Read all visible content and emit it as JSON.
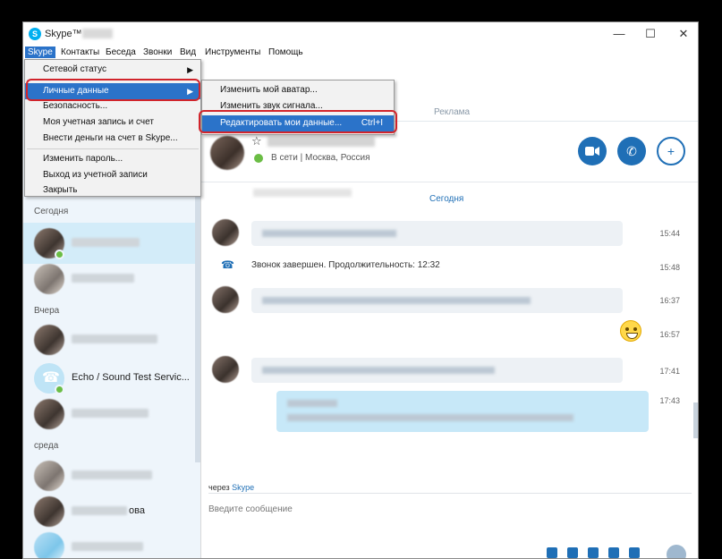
{
  "window": {
    "title": "Skype™ -",
    "controls": [
      "—",
      "☐",
      "✕"
    ]
  },
  "menubar": {
    "items": [
      "Skype",
      "Контакты",
      "Беседа",
      "Звонки",
      "Вид",
      "Инструменты",
      "Помощь"
    ]
  },
  "skype_menu": {
    "items": [
      {
        "label": "Сетевой статус",
        "submenu": true
      },
      {
        "label": "Личные данные",
        "submenu": true,
        "highlighted": true
      },
      {
        "label": "Безопасность..."
      },
      {
        "label": "Моя учетная запись и счет"
      },
      {
        "label": "Внести деньги на счет в Skype..."
      },
      {
        "label": "Изменить пароль..."
      },
      {
        "label": "Выход из учетной записи"
      },
      {
        "label": "Закрыть"
      }
    ]
  },
  "personal_submenu": {
    "items": [
      {
        "label": "Изменить мой аватар..."
      },
      {
        "label": "Изменить звук сигнала..."
      },
      {
        "label": "Редактировать мои данные...",
        "shortcut": "Ctrl+I",
        "highlighted": true
      }
    ]
  },
  "sidebar": {
    "sections": {
      "today": "Сегодня",
      "yesterday": "Вчера",
      "wednesday": "среда"
    },
    "echo_name": "Echo / Sound Test Servic...",
    "partial_name": "ова"
  },
  "header": {
    "ad_label": "Реклама",
    "status_online": "В сети",
    "status_separator": "|",
    "location": "Москва, Россия",
    "call_icons": [
      "video-call-icon",
      "phone-call-icon",
      "add-contact-icon"
    ]
  },
  "chat": {
    "date_label": "Сегодня",
    "call_ended_text": "Звонок завершен. Продолжительность: 12:32",
    "times": [
      "15:44",
      "15:48",
      "16:37",
      "16:57",
      "17:41",
      "17:43"
    ]
  },
  "composer": {
    "via_prefix": "через",
    "via_link": "Skype",
    "placeholder": "Введите сообщение"
  },
  "colors": {
    "accent": "#1f6fb6",
    "highlight": "#2b73c9",
    "ring": "#d1242b",
    "online": "#6bbd45"
  }
}
